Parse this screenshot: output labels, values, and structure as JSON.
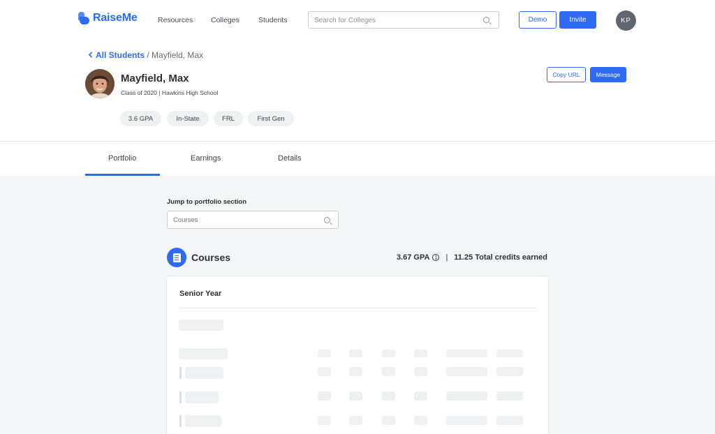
{
  "brand": {
    "name": "RaiseMe",
    "color": "#2f6bf2"
  },
  "nav": {
    "links": [
      "Resources",
      "Colleges",
      "Students"
    ],
    "search_placeholder": "Search for Colleges",
    "demo_label": "Demo",
    "invite_label": "Invite",
    "user_initials": "KP"
  },
  "breadcrumb": {
    "back": "All Students",
    "separator": "/",
    "current": "Mayfield, Max"
  },
  "student": {
    "name": "Mayfield, Max",
    "meta": "Class of 2020 | Hawkins High School",
    "tags": [
      "3.6 GPA",
      "In-State",
      "FRL",
      "First Gen"
    ]
  },
  "actions": {
    "copy_url": "Copy URL",
    "message": "Message"
  },
  "tabs": [
    {
      "label": "Portfolio",
      "active": true
    },
    {
      "label": "Earnings",
      "active": false
    },
    {
      "label": "Details",
      "active": false
    }
  ],
  "jump": {
    "label": "Jump to portfolio section",
    "value": "",
    "placeholder": "Courses"
  },
  "courses": {
    "title": "Courses",
    "gpa": "3.67 GPA",
    "separator": "|",
    "credits": "11.25 Total credits earned",
    "year_title": "Senior Year"
  },
  "icons": {
    "search": "magnifier-icon",
    "back": "chevron-left-icon",
    "info": "info-icon",
    "courses": "document-icon"
  }
}
